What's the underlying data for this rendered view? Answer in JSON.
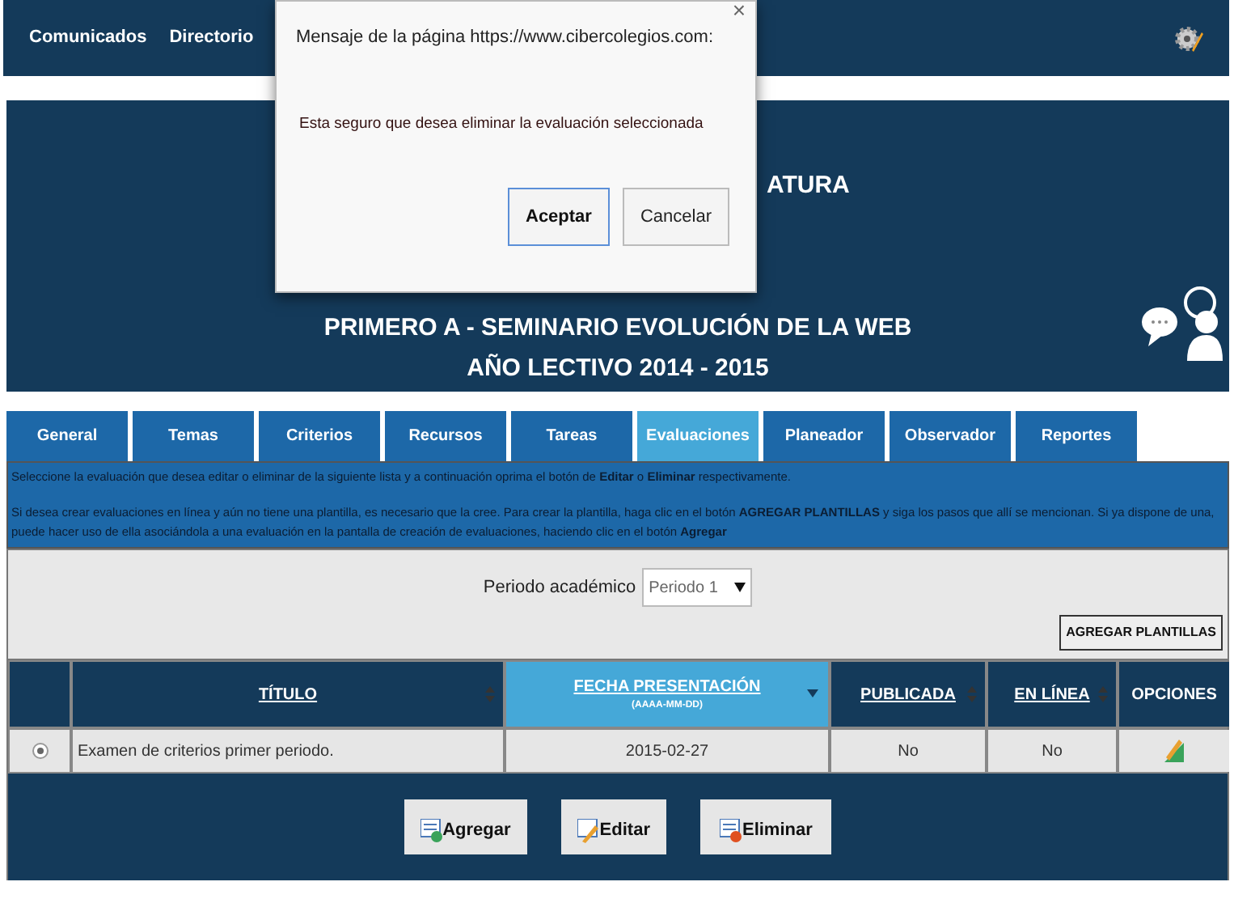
{
  "nav": {
    "links": [
      "Comunicados",
      "Directorio"
    ]
  },
  "header": {
    "lines": [
      "ATURA",
      "PRIMERO A - SEMINARIO EVOLUCIÓN DE LA WEB",
      "AÑO LECTIVO 2014 - 2015"
    ]
  },
  "tabs": [
    {
      "label": "General",
      "selected": false
    },
    {
      "label": "Temas",
      "selected": false
    },
    {
      "label": "Criterios",
      "selected": false
    },
    {
      "label": "Recursos",
      "selected": false
    },
    {
      "label": "Tareas",
      "selected": false
    },
    {
      "label": "Evaluaciones",
      "selected": true
    },
    {
      "label": "Planeador",
      "selected": false
    },
    {
      "label": "Observador",
      "selected": false
    },
    {
      "label": "Reportes",
      "selected": false
    }
  ],
  "info": [
    "Seleccione la evaluación que desea editar o eliminar de la siguiente lista y a continuación oprima el botón de **Editar** o **Eliminar** respectivamente.",
    "Si desea crear evaluaciones en línea y aún no tiene una plantilla, es necesario que la cree. Para crear la plantilla, haga clic en el botón **AGREGAR PLANTILLAS** y siga los pasos que allí se mencionan. Si ya dispone de una, puede hacer uso de ella asociándola a una evaluación en la pantalla de creación de evaluaciones, haciendo clic en el botón **Agregar**"
  ],
  "filter": {
    "label": "Periodo académico",
    "value": "Periodo 1",
    "button": "AGREGAR PLANTILLAS"
  },
  "table": {
    "columns": [
      {
        "label": "TÍTULO",
        "kind": "sortable",
        "selected": false
      },
      {
        "label": "FECHA PRESENTACIÓN",
        "sublabel": "(AAAA-MM-DD)",
        "kind": "sorted",
        "selected": true
      },
      {
        "label": "PUBLICADA",
        "kind": "sortable",
        "selected": false
      },
      {
        "label": "EN LÍNEA",
        "kind": "sortable",
        "selected": false
      },
      {
        "label": "OPCIONES",
        "kind": "plain",
        "selected": false
      }
    ],
    "rows": [
      {
        "selected": true,
        "title": "Examen de criterios primer periodo.",
        "date": "2015-02-27",
        "published": "No",
        "online": "No"
      }
    ]
  },
  "actions": [
    {
      "kind": "add",
      "label": "Agregar"
    },
    {
      "kind": "edit",
      "label": "Editar"
    },
    {
      "kind": "delete",
      "label": "Eliminar"
    }
  ],
  "dialog": {
    "title": "Mensaje de la página https://www.cibercolegios.com:",
    "close": "×",
    "message": "Esta seguro que desea eliminar la evaluación seleccionada",
    "buttons": [
      {
        "label": "Aceptar",
        "selected": true
      },
      {
        "label": "Cancelar",
        "selected": false
      }
    ]
  }
}
